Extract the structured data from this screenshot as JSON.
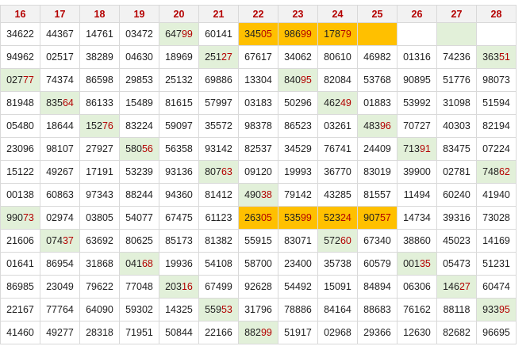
{
  "colors": {
    "header_text": "#b40000",
    "header_bg": "#f2f2f2",
    "highlight_digits": "#b40000",
    "green_cell": "#e2f0d9",
    "orange_cell": "#ffc000"
  },
  "columns": [
    "16",
    "17",
    "18",
    "19",
    "20",
    "21",
    "22",
    "23",
    "24",
    "25",
    "26",
    "27",
    "28"
  ],
  "rows": [
    [
      "34622",
      "44367",
      "14761",
      "03472",
      "64799",
      "60141",
      "34505",
      "98699",
      "17879",
      "",
      "",
      "",
      ""
    ],
    [
      "94962",
      "02517",
      "38289",
      "04630",
      "18969",
      "25127",
      "67617",
      "34062",
      "80610",
      "46982",
      "01316",
      "74236",
      "36351"
    ],
    [
      "02777",
      "74374",
      "86598",
      "29853",
      "25132",
      "69886",
      "13304",
      "84095",
      "82084",
      "53768",
      "90895",
      "51776",
      "98073"
    ],
    [
      "81948",
      "83564",
      "86133",
      "15489",
      "81615",
      "57997",
      "03183",
      "50296",
      "46249",
      "01883",
      "53992",
      "31098",
      "51594"
    ],
    [
      "05480",
      "18644",
      "15276",
      "83224",
      "59097",
      "35572",
      "98378",
      "86523",
      "03261",
      "48396",
      "70727",
      "40303",
      "82194"
    ],
    [
      "23096",
      "98107",
      "27927",
      "58056",
      "56358",
      "93142",
      "82537",
      "34529",
      "76741",
      "24409",
      "71391",
      "83475",
      "07224"
    ],
    [
      "15122",
      "49267",
      "17191",
      "53239",
      "93136",
      "80763",
      "09120",
      "19993",
      "36770",
      "83019",
      "39900",
      "02781",
      "74862"
    ],
    [
      "00138",
      "60863",
      "97343",
      "88244",
      "94360",
      "81412",
      "49038",
      "79142",
      "43285",
      "81557",
      "11494",
      "60240",
      "41940"
    ],
    [
      "99073",
      "02974",
      "03805",
      "54077",
      "67475",
      "61123",
      "26305",
      "53599",
      "52324",
      "90757",
      "14734",
      "39316",
      "73028"
    ],
    [
      "21606",
      "07437",
      "63692",
      "80625",
      "85173",
      "81382",
      "55915",
      "83071",
      "57260",
      "67340",
      "38860",
      "45023",
      "14169"
    ],
    [
      "01641",
      "86954",
      "31868",
      "04168",
      "19936",
      "54108",
      "58700",
      "23400",
      "35738",
      "60579",
      "00135",
      "05473",
      "51231"
    ],
    [
      "86985",
      "23049",
      "79622",
      "77048",
      "20316",
      "67499",
      "92628",
      "54492",
      "15091",
      "84894",
      "06306",
      "14627",
      "60474"
    ],
    [
      "22167",
      "77764",
      "64090",
      "59302",
      "14325",
      "55953",
      "31796",
      "78886",
      "84164",
      "88683",
      "76162",
      "88118",
      "93395"
    ],
    [
      "41460",
      "49277",
      "28318",
      "71951",
      "50844",
      "22166",
      "88299",
      "51917",
      "02968",
      "29366",
      "12630",
      "82682",
      "96695"
    ]
  ],
  "cell_fill": [
    [
      "",
      "",
      "",
      "",
      "g",
      "",
      "o",
      "o",
      "o",
      "o",
      "",
      "g",
      ""
    ],
    [
      "",
      "",
      "",
      "",
      "",
      "g",
      "",
      "",
      "",
      "",
      "",
      "",
      "g"
    ],
    [
      "g",
      "",
      "",
      "",
      "",
      "",
      "",
      "g",
      "",
      "",
      "",
      "",
      ""
    ],
    [
      "",
      "g",
      "",
      "",
      "",
      "",
      "",
      "",
      "g",
      "",
      "",
      "",
      ""
    ],
    [
      "",
      "",
      "g",
      "",
      "",
      "",
      "",
      "",
      "",
      "g",
      "",
      "",
      ""
    ],
    [
      "",
      "",
      "",
      "g",
      "",
      "",
      "",
      "",
      "",
      "",
      "g",
      "",
      ""
    ],
    [
      "",
      "",
      "",
      "",
      "",
      "g",
      "",
      "",
      "",
      "",
      "",
      "",
      "g"
    ],
    [
      "",
      "",
      "",
      "",
      "",
      "",
      "g",
      "",
      "",
      "",
      "",
      "",
      ""
    ],
    [
      "g",
      "",
      "",
      "",
      "",
      "",
      "o",
      "o",
      "o",
      "o",
      "",
      "",
      ""
    ],
    [
      "",
      "g",
      "",
      "",
      "",
      "",
      "",
      "",
      "g",
      "",
      "",
      "",
      ""
    ],
    [
      "",
      "",
      "",
      "g",
      "",
      "",
      "",
      "",
      "",
      "",
      "g",
      "",
      ""
    ],
    [
      "",
      "",
      "",
      "",
      "g",
      "",
      "",
      "",
      "",
      "",
      "",
      "g",
      ""
    ],
    [
      "",
      "",
      "",
      "",
      "",
      "g",
      "",
      "",
      "",
      "",
      "",
      "",
      "g"
    ],
    [
      "",
      "",
      "",
      "",
      "",
      "",
      "g",
      "",
      "",
      "",
      "",
      "",
      ""
    ]
  ],
  "highlight_last_digits": [
    [
      0,
      0,
      0,
      0,
      2,
      0,
      2,
      2,
      2,
      0,
      0,
      0,
      0
    ],
    [
      0,
      0,
      0,
      0,
      0,
      2,
      0,
      0,
      0,
      0,
      0,
      0,
      2
    ],
    [
      2,
      0,
      0,
      0,
      0,
      0,
      0,
      2,
      0,
      0,
      0,
      0,
      0
    ],
    [
      0,
      2,
      0,
      0,
      0,
      0,
      0,
      0,
      2,
      0,
      0,
      0,
      0
    ],
    [
      0,
      0,
      2,
      0,
      0,
      0,
      0,
      0,
      0,
      2,
      0,
      0,
      0
    ],
    [
      0,
      0,
      0,
      2,
      0,
      0,
      0,
      0,
      0,
      0,
      2,
      0,
      0
    ],
    [
      0,
      0,
      0,
      0,
      0,
      2,
      0,
      0,
      0,
      0,
      0,
      0,
      2
    ],
    [
      0,
      0,
      0,
      0,
      0,
      0,
      2,
      0,
      0,
      0,
      0,
      0,
      0
    ],
    [
      2,
      0,
      0,
      0,
      0,
      0,
      2,
      2,
      2,
      2,
      0,
      0,
      0
    ],
    [
      0,
      2,
      0,
      0,
      0,
      0,
      0,
      0,
      2,
      0,
      0,
      0,
      0
    ],
    [
      0,
      0,
      0,
      2,
      0,
      0,
      0,
      0,
      0,
      0,
      2,
      0,
      0
    ],
    [
      0,
      0,
      0,
      0,
      2,
      0,
      0,
      0,
      0,
      0,
      0,
      2,
      0
    ],
    [
      0,
      0,
      0,
      0,
      0,
      2,
      0,
      0,
      0,
      0,
      0,
      0,
      2
    ],
    [
      0,
      0,
      0,
      0,
      0,
      0,
      2,
      0,
      0,
      0,
      0,
      0,
      0
    ]
  ]
}
